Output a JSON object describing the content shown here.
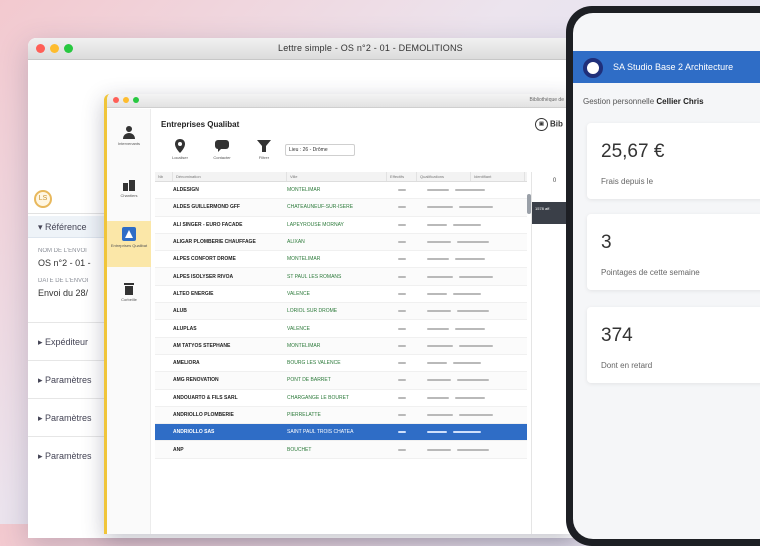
{
  "back_window": {
    "title": "Lettre simple - OS n°2 - 01 - DEMOLITIONS",
    "badge": "LS",
    "section_open": "Référence",
    "field1_label": "NOM DE L'ENVOI",
    "field1_value": "OS n°2 - 01 -",
    "field2_label": "DATE DE L'ENVOI",
    "field2_value": "Envoi du 28/",
    "collapsed_sections": [
      "Expéditeur",
      "Paramètres",
      "Paramètres",
      "Paramètres"
    ]
  },
  "mid_window": {
    "top_right_text": "Bibliothèque de",
    "header_title": "Entreprises Qualibat",
    "header_right": "Bib",
    "sidebar": [
      "Intervenants",
      "Chantiers",
      "Entreprises Qualibat",
      "Corbeille"
    ],
    "toolbar": [
      "Localiser",
      "Contacter",
      "Filtrer"
    ],
    "filter_text": "Lieu : 26 - Drôme",
    "columns": [
      "Nb",
      "Dénomination",
      "Ville",
      "Effectifs",
      "Qualifications",
      "Identifiant"
    ],
    "side_panel_header": "0",
    "side_panel_text": "1578 aff.",
    "rows": [
      {
        "name": "ALDESIGN",
        "city": "MONTELIMAR"
      },
      {
        "name": "ALDES GUILLERMOND GFF",
        "city": "CHATEAUNEUF-SUR-ISERE"
      },
      {
        "name": "ALI SINGER - EURO FACADE",
        "city": "LAPEYROUSE MORNAY"
      },
      {
        "name": "ALIGAR PLOMBERIE CHAUFFAGE",
        "city": "ALIXAN"
      },
      {
        "name": "ALPES CONFORT DROME",
        "city": "MONTELIMAR"
      },
      {
        "name": "ALPES ISOLYSER RIVOA",
        "city": "ST PAUL LES ROMANS"
      },
      {
        "name": "ALTEO ENERGIE",
        "city": "VALENCE"
      },
      {
        "name": "ALUB",
        "city": "LORIOL SUR DROME"
      },
      {
        "name": "ALUPLAS",
        "city": "VALENCE"
      },
      {
        "name": "AM TATYOS STEPHANE",
        "city": "MONTELIMAR"
      },
      {
        "name": "AMELIORA",
        "city": "BOURG LES VALENCE"
      },
      {
        "name": "AMG RENOVATION",
        "city": "PONT DE BARRET"
      },
      {
        "name": "ANDOUARTO & FILS SARL",
        "city": "CHARGANGE LE BOURET"
      },
      {
        "name": "ANDRIOLLO PLOMBERIE",
        "city": "PIERRELATTE"
      },
      {
        "name": "ANDRIOLLO SAS",
        "city": "SAINT PAUL TROIS CHATEA"
      },
      {
        "name": "ANP",
        "city": "BOUCHET"
      }
    ],
    "selected_row_index": 14
  },
  "tablet": {
    "company": "SA Studio Base 2 Architecture",
    "subtitle_prefix": "Gestion personnelle",
    "subtitle_name": "Cellier Chris",
    "cards": [
      {
        "value": "25,67 €",
        "label": "Frais depuis le"
      },
      {
        "value": "3",
        "label": "Pointages de cette semaine"
      },
      {
        "value": "374",
        "label": "Dont en retard"
      }
    ]
  },
  "colors": {
    "accent_blue": "#2f6dc6",
    "sidebar_yellow": "#f0c53a",
    "city_green": "#2c7a3a"
  }
}
